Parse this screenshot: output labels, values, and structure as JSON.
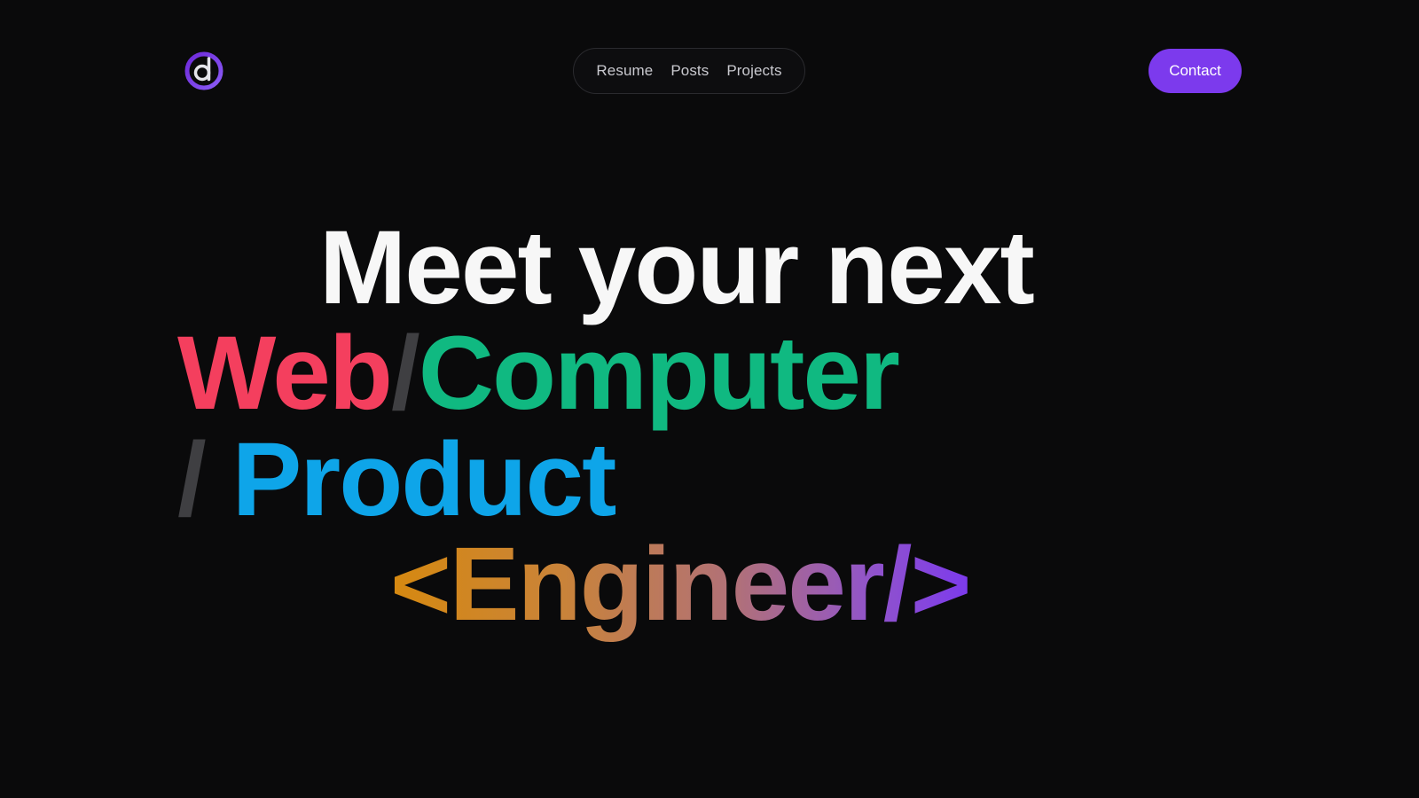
{
  "header": {
    "logo_icon": "d-logo-icon",
    "nav": {
      "items": [
        {
          "label": "Resume"
        },
        {
          "label": "Posts"
        },
        {
          "label": "Projects"
        }
      ]
    },
    "contact_label": "Contact"
  },
  "hero": {
    "line1": "Meet your next",
    "line2": {
      "word1": "Web",
      "sep": "/",
      "word2": "Computer"
    },
    "line3": {
      "sep": "/ ",
      "word": "Product"
    },
    "line4": "<Engineer/>"
  },
  "colors": {
    "background": "#0a0a0b",
    "accent": "#7c3aed",
    "web": "#f43f5e",
    "computer": "#10b981",
    "product": "#0ea5e9",
    "separator": "#3f3f42",
    "engineer_gradient_start": "#d68910",
    "engineer_gradient_end": "#7c3aed"
  }
}
